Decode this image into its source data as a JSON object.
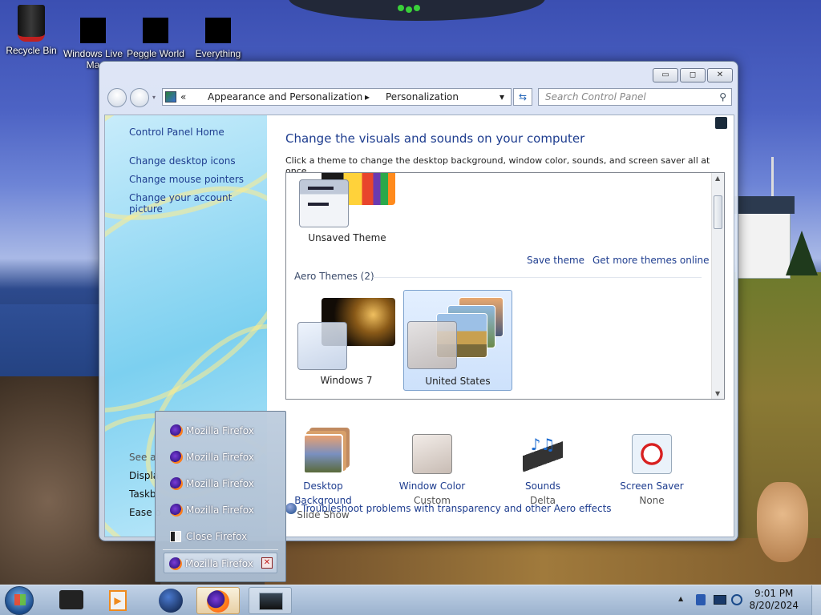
{
  "desktop": {
    "icons": [
      {
        "label": "Recycle Bin"
      },
      {
        "label": "Windows Live Ma"
      },
      {
        "label": "Peggle World"
      },
      {
        "label": "Everything"
      }
    ]
  },
  "window": {
    "buttons": {
      "minimize": "▭",
      "maximize": "◻",
      "close": "✕"
    },
    "address": {
      "chevrons": "«",
      "crumb1": "Appearance and Personalization",
      "separator": "▸",
      "crumb2": "Personalization",
      "dropdown": "▾"
    },
    "search_placeholder": "Search Control Panel",
    "sidebar": {
      "home": "Control Panel Home",
      "links": [
        "Change desktop icons",
        "Change mouse pointers",
        "Change your account picture"
      ],
      "see_also_partial": "See al",
      "see_also_links": [
        "Displa",
        "Taskb",
        "Ease o"
      ]
    },
    "main": {
      "title": "Change the visuals and sounds on your computer",
      "subtitle": "Click a theme to change the desktop background, window color, sounds, and screen saver all at once.",
      "unsaved_theme": "Unsaved Theme",
      "save_theme": "Save theme",
      "get_more": "Get more themes online",
      "aero_header": "Aero Themes (2)",
      "themes": [
        {
          "label": "Windows 7",
          "selected": false
        },
        {
          "label": "United States",
          "selected": true
        }
      ],
      "bottom_items": [
        {
          "title": "Desktop Background",
          "value": "Slide Show"
        },
        {
          "title": "Window Color",
          "value": "Custom"
        },
        {
          "title": "Sounds",
          "value": "Delta"
        },
        {
          "title": "Screen Saver",
          "value": "None"
        }
      ],
      "troubleshoot": "Troubleshoot problems with transparency and other Aero effects"
    }
  },
  "jumplist": {
    "items": [
      "Mozilla Firefox",
      "Mozilla Firefox",
      "Mozilla Firefox",
      "Mozilla Firefox",
      "Close Firefox"
    ],
    "hovered": "Mozilla Firefox",
    "close_glyph": "✕"
  },
  "taskbar": {
    "time": "9:01 PM",
    "date": "8/20/2024",
    "tray_arrow": "▲"
  }
}
